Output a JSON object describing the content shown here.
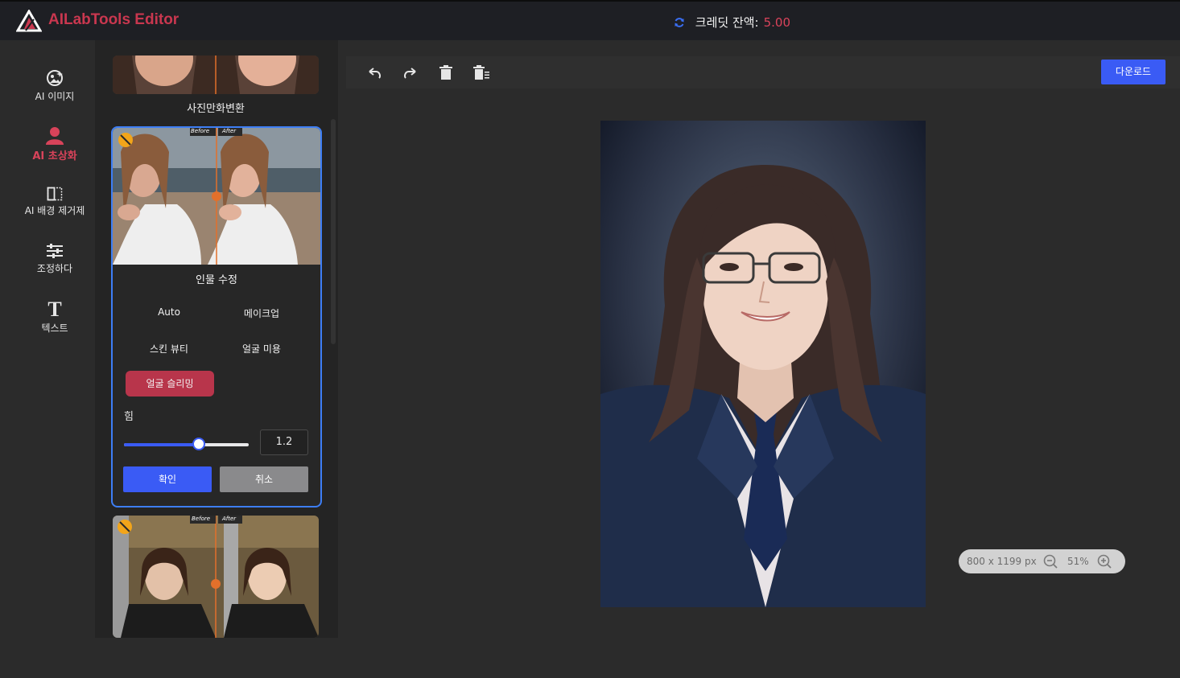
{
  "header": {
    "brand": "AILabTools Editor",
    "credit_label": "크레딧 잔액:",
    "credit_value": "5.00",
    "brand_color": "#c9374f"
  },
  "sidebar": {
    "items": [
      {
        "label": "AI 이미지",
        "icon": "ai-image-icon"
      },
      {
        "label": "AI 초상화",
        "icon": "portrait-icon",
        "active": true
      },
      {
        "label": "AI 배경 제거제",
        "icon": "background-remove-icon"
      },
      {
        "label": "조정하다",
        "icon": "sliders-icon"
      },
      {
        "label": "텍스트",
        "icon": "text-icon"
      }
    ]
  },
  "panel": {
    "top_card_title": "사진만화변환",
    "active_card": {
      "title": "인물 수정",
      "before_label": "Before",
      "after_label": "After",
      "options": [
        "Auto",
        "메이크업",
        "스킨 뷰티",
        "얼굴 미용",
        "얼굴 슬리밍"
      ],
      "selected_option": "얼굴 슬리밍",
      "strength_label": "힘",
      "strength_value": "1.2",
      "strength_fraction": 0.6,
      "confirm_label": "확인",
      "cancel_label": "취소"
    },
    "bottom_card": {
      "before_label": "Before",
      "after_label": "After"
    }
  },
  "toolbar": {
    "tools": [
      "undo-icon",
      "redo-icon",
      "delete-icon",
      "delete-all-icon"
    ],
    "download_label": "다운로드"
  },
  "canvas": {
    "dimensions": "800 x 1199 px",
    "zoom": "51%"
  },
  "colors": {
    "accent": "#3a5bf5",
    "active_red": "#d8435a",
    "selected_option": "#b8354b"
  }
}
